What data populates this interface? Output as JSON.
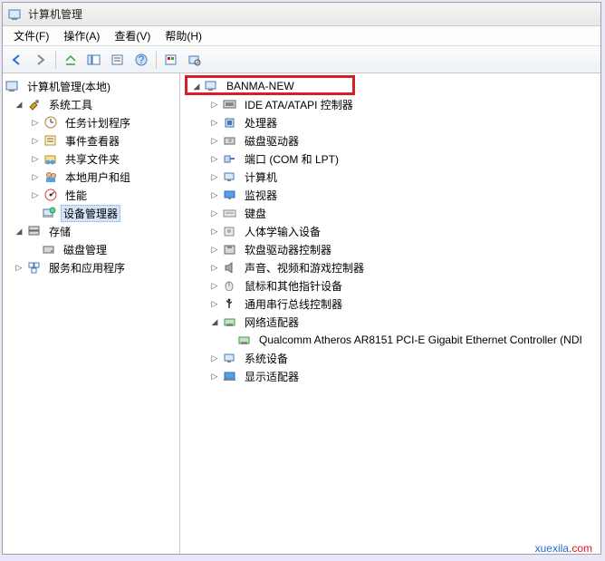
{
  "window": {
    "title": "计算机管理"
  },
  "menubar": {
    "file": "文件(F)",
    "action": "操作(A)",
    "view": "查看(V)",
    "help": "帮助(H)"
  },
  "left_tree": {
    "root": "计算机管理(本地)",
    "system_tools": "系统工具",
    "task_scheduler": "任务计划程序",
    "event_viewer": "事件查看器",
    "shared_folders": "共享文件夹",
    "local_users": "本地用户和组",
    "performance": "性能",
    "device_manager": "设备管理器",
    "storage": "存储",
    "disk_management": "磁盘管理",
    "services_apps": "服务和应用程序"
  },
  "right_tree": {
    "root": "BANMA-NEW",
    "ide": "IDE ATA/ATAPI 控制器",
    "cpu": "处理器",
    "disk_drives": "磁盘驱动器",
    "ports": "端口 (COM 和 LPT)",
    "computer": "计算机",
    "monitors": "监视器",
    "keyboards": "键盘",
    "hid": "人体学输入设备",
    "floppy_ctrl": "软盘驱动器控制器",
    "sound": "声音、视频和游戏控制器",
    "mouse": "鼠标和其他指针设备",
    "usb": "通用串行总线控制器",
    "network": "网络适配器",
    "nic": "Qualcomm Atheros AR8151 PCI-E Gigabit Ethernet Controller (NDI",
    "system_devices": "系统设备",
    "display": "显示适配器"
  },
  "watermark": {
    "a": "xuexila",
    "b": ".com"
  }
}
